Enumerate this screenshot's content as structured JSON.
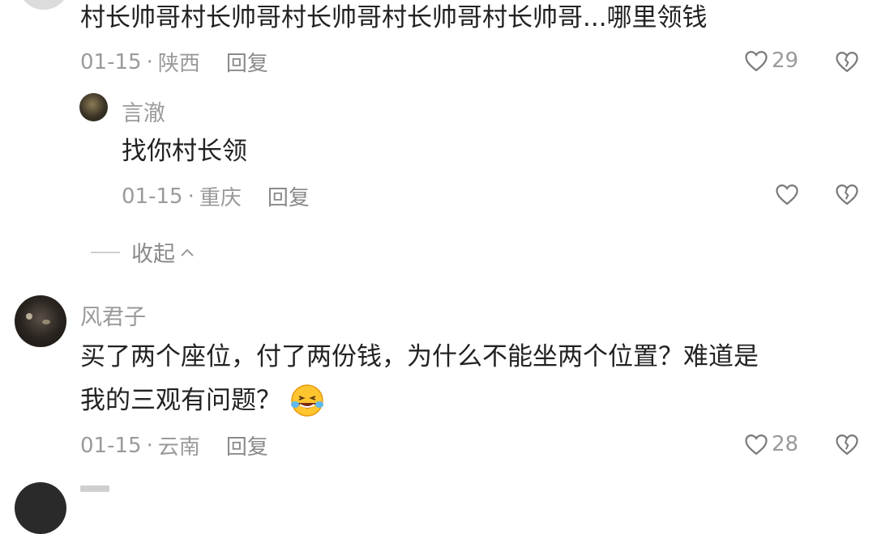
{
  "comment1": {
    "text": "村长帅哥村长帅哥村长帅哥村长帅哥村长帅哥...哪里领钱",
    "date": "01-15",
    "sep": "·",
    "location": "陕西",
    "reply_label": "回复",
    "like_count": "29"
  },
  "reply1": {
    "username": "言澈",
    "text": "找你村长领",
    "date": "01-15",
    "sep": "·",
    "location": "重庆",
    "reply_label": "回复"
  },
  "collapse": {
    "label": "收起"
  },
  "comment2": {
    "username": "风君子",
    "text_line1": "买了两个座位，付了两份钱，为什么不能坐两个位置？难道是",
    "text_line2": "我的三观有问题？",
    "date": "01-15",
    "sep": "·",
    "location": "云南",
    "reply_label": "回复",
    "like_count": "28"
  },
  "colors": {
    "text": "#222222",
    "meta": "#9a9a9a",
    "icon": "#7a7a7a"
  }
}
